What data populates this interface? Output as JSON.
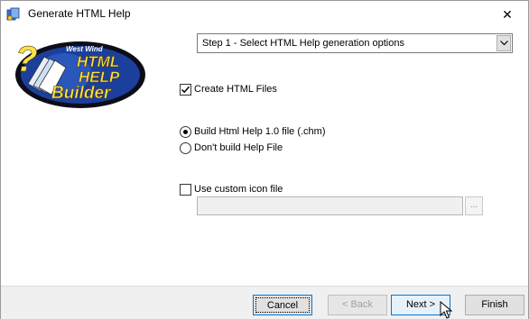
{
  "window": {
    "title": "Generate HTML Help",
    "close_glyph": "✕"
  },
  "logo": {
    "brand_small": "West Wind",
    "line1": "HTML",
    "line2": "HELP",
    "line3": "Builder",
    "question_mark": "?"
  },
  "step_select": {
    "selected": "Step 1 - Select HTML Help generation options"
  },
  "options": {
    "create_html_files": {
      "label": "Create HTML Files",
      "checked": true
    },
    "build_chm": {
      "label": "Build Html Help 1.0 file (.chm)",
      "selected": true
    },
    "dont_build": {
      "label": "Don't build Help File",
      "selected": false
    },
    "custom_icon": {
      "label": "Use custom icon file",
      "checked": false,
      "value": "",
      "browse_label": "..."
    }
  },
  "buttons": {
    "cancel": "Cancel",
    "back": "< Back",
    "next": "Next >",
    "finish": "Finish"
  },
  "colors": {
    "accent": "#0078d7",
    "logo_yellow": "#f6e34a",
    "logo_blue": "#1b3f9c"
  }
}
